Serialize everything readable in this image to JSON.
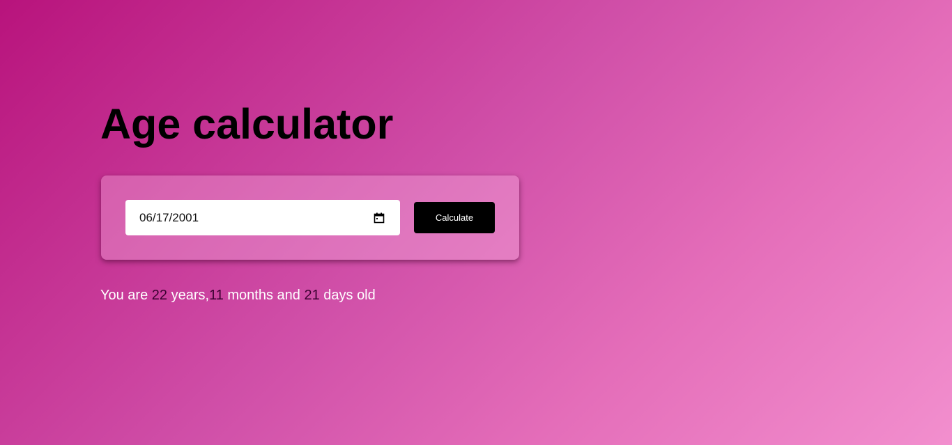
{
  "title": "Age calculator",
  "date_input": {
    "value": "06/17/2001"
  },
  "calculate_button": {
    "label": "Calculate"
  },
  "result": {
    "prefix": "You are ",
    "years": "22",
    "years_label": " years,",
    "months": "11",
    "months_label": " months and ",
    "days": "21",
    "days_label": " days old"
  },
  "colors": {
    "gradient_start": "#b8137c",
    "gradient_end": "#f28fce",
    "button_bg": "#000000",
    "number_color": "#3a0030"
  },
  "icons": {
    "date_picker": "calendar-icon"
  }
}
